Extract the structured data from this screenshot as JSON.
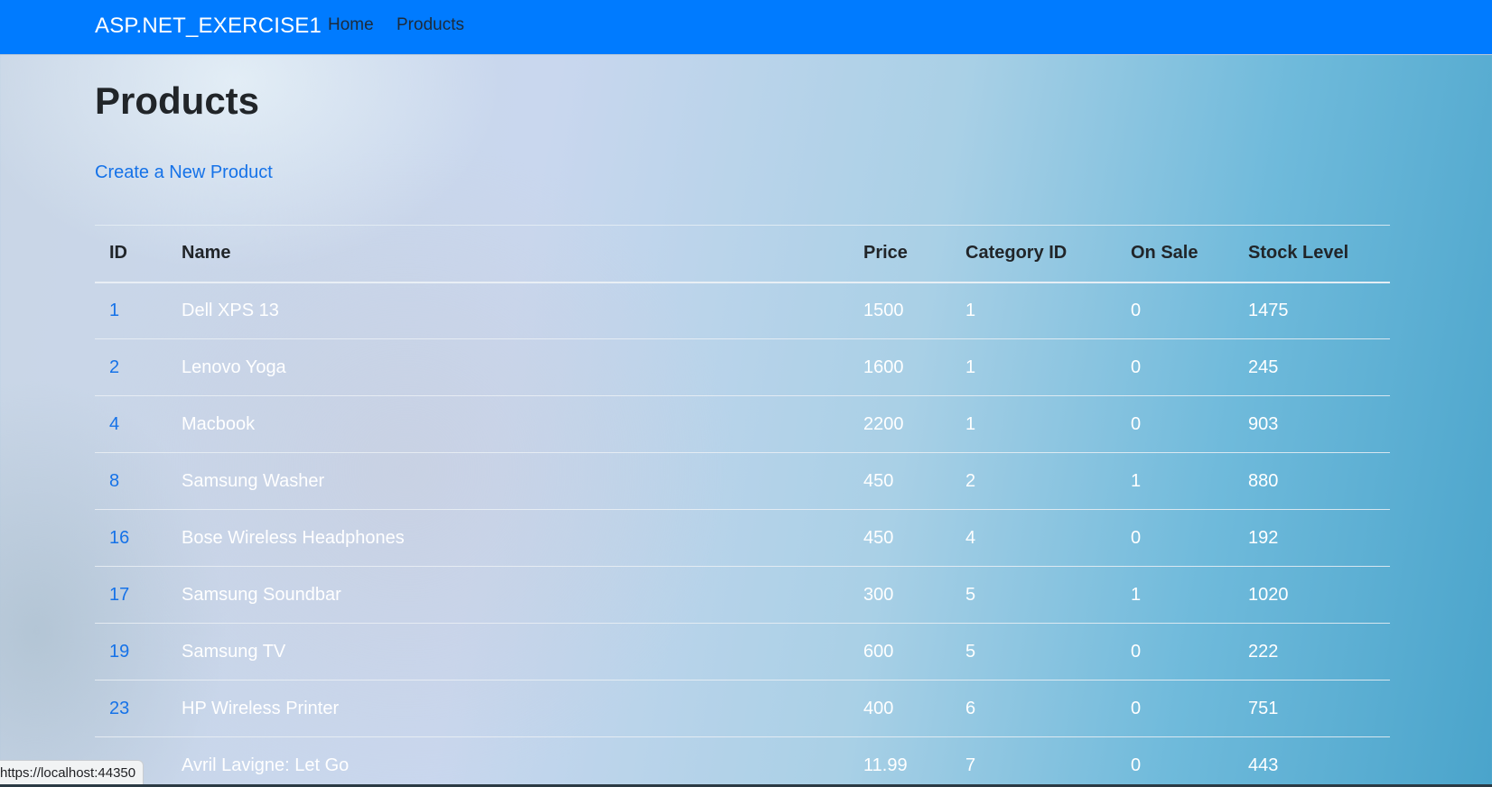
{
  "navbar": {
    "brand": "ASP.NET_EXERCISE1",
    "links": [
      {
        "label": "Home"
      },
      {
        "label": "Products"
      }
    ]
  },
  "page": {
    "title": "Products",
    "create_link": "Create a New Product"
  },
  "table": {
    "headers": [
      "ID",
      "Name",
      "Price",
      "Category ID",
      "On Sale",
      "Stock Level"
    ],
    "rows": [
      [
        "1",
        "Dell XPS 13",
        "1500",
        "1",
        "0",
        "1475"
      ],
      [
        "2",
        "Lenovo Yoga",
        "1600",
        "1",
        "0",
        "245"
      ],
      [
        "4",
        "Macbook",
        "2200",
        "1",
        "0",
        "903"
      ],
      [
        "8",
        "Samsung Washer",
        "450",
        "2",
        "1",
        "880"
      ],
      [
        "16",
        "Bose Wireless Headphones",
        "450",
        "4",
        "0",
        "192"
      ],
      [
        "17",
        "Samsung Soundbar",
        "300",
        "5",
        "1",
        "1020"
      ],
      [
        "19",
        "Samsung TV",
        "600",
        "5",
        "0",
        "222"
      ],
      [
        "23",
        "HP Wireless Printer",
        "400",
        "6",
        "0",
        "751"
      ],
      [
        "",
        "Avril Lavigne: Let Go",
        "11.99",
        "7",
        "0",
        "443"
      ]
    ]
  },
  "status_bar": {
    "url": "https://localhost:44350"
  },
  "colors": {
    "navbar_bg": "#007bff",
    "link": "#1572e8",
    "cell_text": "#ffffff"
  }
}
